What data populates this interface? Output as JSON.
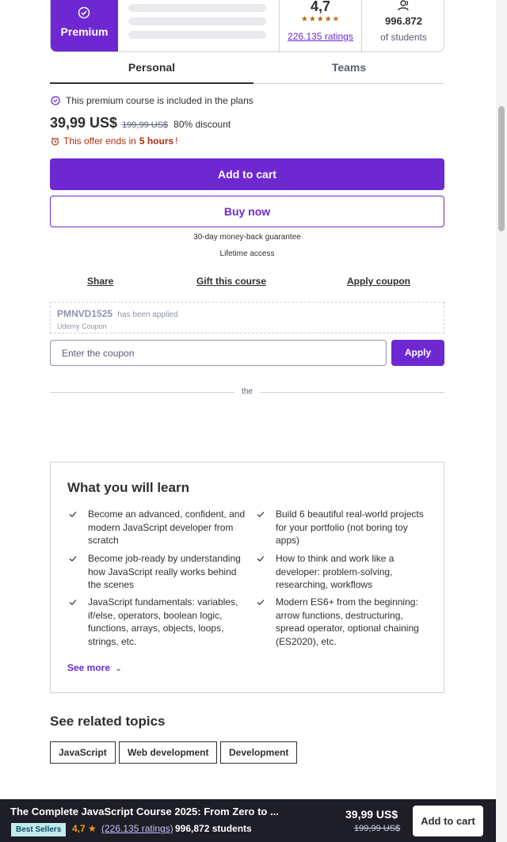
{
  "premium": {
    "badge_label": "Premium",
    "rating_value": "4,7",
    "ratings_count": "226.135 ratings",
    "students_count": "996.872",
    "students_label": "of students"
  },
  "tabs": [
    {
      "label": "Personal",
      "active": true
    },
    {
      "label": "Teams",
      "active": false
    }
  ],
  "purchase": {
    "plan_note": "This premium course is included in the plans",
    "price_current": "39,99 US$",
    "price_original": "199,99 US$",
    "discount": "80% discount",
    "offer_prefix": "This offer ends in",
    "offer_time": "5 hours",
    "offer_suffix": "!",
    "add_to_cart": "Add to cart",
    "buy_now": "Buy now",
    "guarantee": "30-day money-back guarantee",
    "lifetime": "Lifetime access"
  },
  "actions": {
    "share": "Share",
    "gift": "Gift this course",
    "apply_coupon": "Apply coupon"
  },
  "coupon": {
    "code": "PMNVD1525",
    "applied_text": "has been applied",
    "source": "Udemy Coupon",
    "input_placeholder": "Enter the coupon",
    "apply_button": "Apply"
  },
  "divider_text": "the",
  "learn": {
    "title": "What you will learn",
    "items": [
      {
        "lines": [
          "Become an advanced, confident, and",
          "modern JavaScript developer from",
          "scratch"
        ]
      },
      {
        "lines": [
          "Build 6 beautiful real-world projects",
          "for your portfolio (not boring toy",
          "apps)"
        ]
      },
      {
        "lines": [
          "Become job-ready by understanding",
          "how JavaScript really works behind",
          "the scenes"
        ]
      },
      {
        "lines": [
          "How to think and work like a",
          "developer: problem-solving,",
          "researching, workflows"
        ]
      },
      {
        "lines": [
          "JavaScript fundamentals: variables,",
          "if/else, operators, boolean logic,",
          "functions, arrays, objects, loops,",
          "strings, etc."
        ]
      },
      {
        "lines": [
          "Modern ES6+ from the beginning:",
          "arrow functions, destructuring,",
          "spread operator, optional chaining",
          "(ES2020), etc."
        ]
      }
    ],
    "see_more": "See more"
  },
  "related": {
    "title": "See related topics",
    "topics": [
      "JavaScript",
      "Web development",
      "Development"
    ]
  },
  "sticky": {
    "title": "The Complete JavaScript Course 2025: From Zero to ...",
    "badge": "Best Sellers",
    "rating": "4,7",
    "ratings_count": "(226.135 ratings)",
    "students": "996,872 students",
    "price_current": "39,99 US$",
    "price_original": "199,99 US$",
    "add_to_cart": "Add to cart"
  },
  "colors": {
    "accent": "#6d28d2",
    "text": "#2d2f31",
    "alert": "#b32d0f",
    "star": "#b4690e",
    "footer_bg": "#1d1e27"
  }
}
